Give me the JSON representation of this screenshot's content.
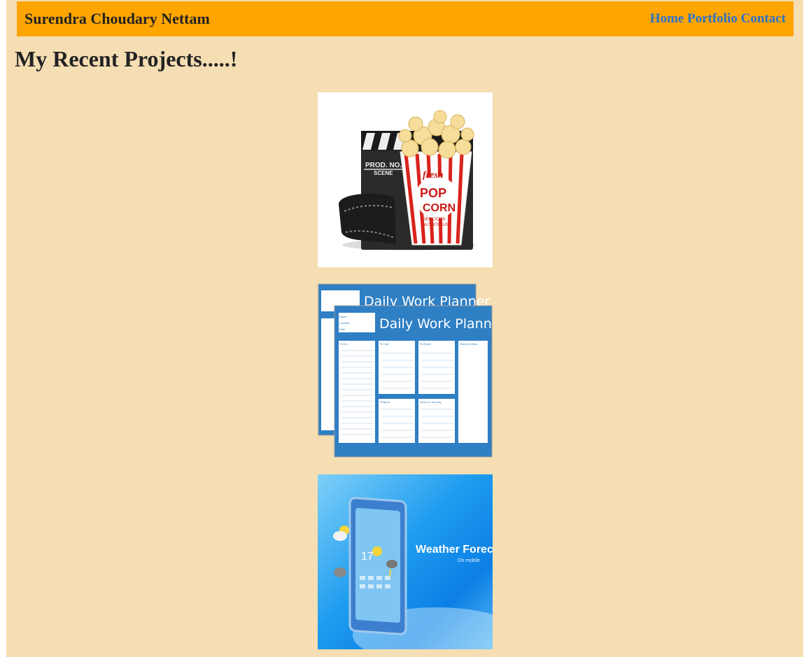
{
  "header": {
    "brand": "Surendra Choudary Nettam",
    "nav": [
      "Home",
      "Portfolio",
      "Contact"
    ]
  },
  "main": {
    "title": "My Recent Projects.....!"
  },
  "projects": [
    {
      "image_text": [
        "PROD. NO.",
        "SCENE",
        "fresh",
        "POP",
        "CORN",
        "DELICIOUS",
        "NUTRITIOUS"
      ]
    },
    {
      "image_text": [
        "Daily Work Planner",
        "Name",
        "Location",
        "Date",
        "To Do",
        "To Call",
        "To Email",
        "Notes & Ideas",
        "Projects",
        "Move to next day",
        "Creativity"
      ]
    },
    {
      "image_text": [
        "Weather Forecast",
        "On mobile",
        "17°"
      ]
    }
  ],
  "colors": {
    "page_bg": "#f5deb3",
    "header_bg": "#ffa500",
    "nav_link": "#2a72c8"
  }
}
